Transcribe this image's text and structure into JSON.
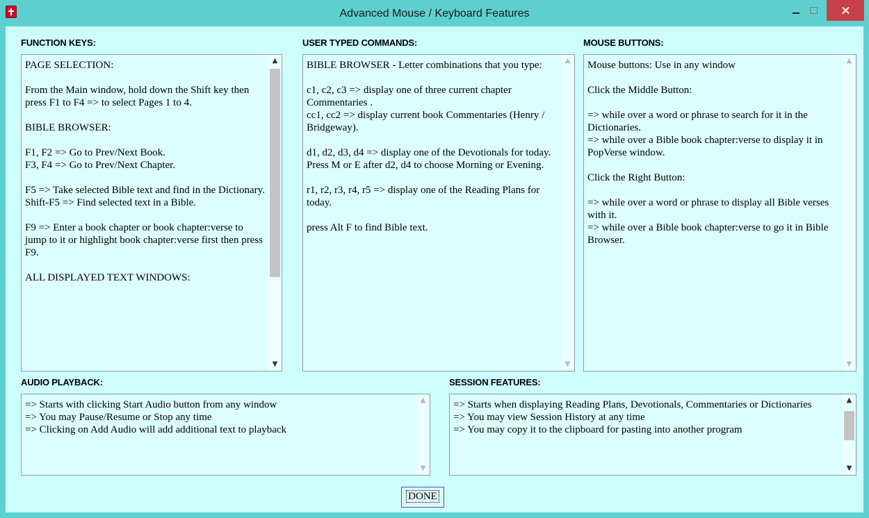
{
  "window": {
    "title": "Advanced Mouse / Keyboard Features",
    "icon": "bible-icon",
    "accent": "#5fd0d0",
    "close_color": "#c7404a",
    "panel_bg": "#ddfefe"
  },
  "sections": {
    "function_keys": {
      "label": "FUNCTION KEYS:",
      "text": "PAGE SELECTION:\n\nFrom the Main window, hold down the Shift key then press F1 to F4 => to select Pages 1 to 4.\n\nBIBLE BROWSER:\n\nF1, F2 => Go to Prev/Next Book.\nF3, F4 => Go to Prev/Next Chapter.\n\nF5 => Take selected Bible text and find in the Dictionary.\nShift-F5 => Find selected text in a Bible.\n\nF9 => Enter a book chapter or book chapter:verse to jump to it or highlight book chapter:verse first then press F9.\n\nALL DISPLAYED TEXT WINDOWS:"
    },
    "user_typed_commands": {
      "label": "USER TYPED COMMANDS:",
      "text": "BIBLE BROWSER - Letter combinations that you type:\n\nc1, c2, c3 => display one of three current chapter Commentaries .\ncc1, cc2 => display current book Commentaries (Henry / Bridgeway).\n\nd1, d2, d3, d4 => display one of the Devotionals for today. Press M or E after d2, d4 to choose Morning or Evening.\n\nr1, r2, r3, r4, r5 => display one of the Reading Plans for today.\n\npress Alt F to find Bible text."
    },
    "mouse_buttons": {
      "label": "MOUSE BUTTONS:",
      "text": "Mouse buttons: Use in any window\n\nClick the Middle Button:\n\n=> while over a word or phrase to search for it in the Dictionaries.\n=> while over a Bible book chapter:verse to display it in PopVerse window.\n\nClick the Right Button:\n\n=> while over a word or phrase to display all Bible verses with it.\n=> while over a Bible book chapter:verse to go it in Bible Browser."
    },
    "audio_playback": {
      "label": "AUDIO PLAYBACK:",
      "text": "=> Starts with clicking Start Audio button from any window\n=> You may Pause/Resume or Stop any time\n=> Clicking on Add Audio will add additional text to playback"
    },
    "session_features": {
      "label": "SESSION FEATURES:",
      "text": "=> Starts when displaying Reading Plans, Devotionals, Commentaries or Dictionaries\n=> You may view Session History at any time\n=> You may copy it to the clipboard for pasting into another program"
    }
  },
  "done_button": {
    "label": "DONE"
  }
}
